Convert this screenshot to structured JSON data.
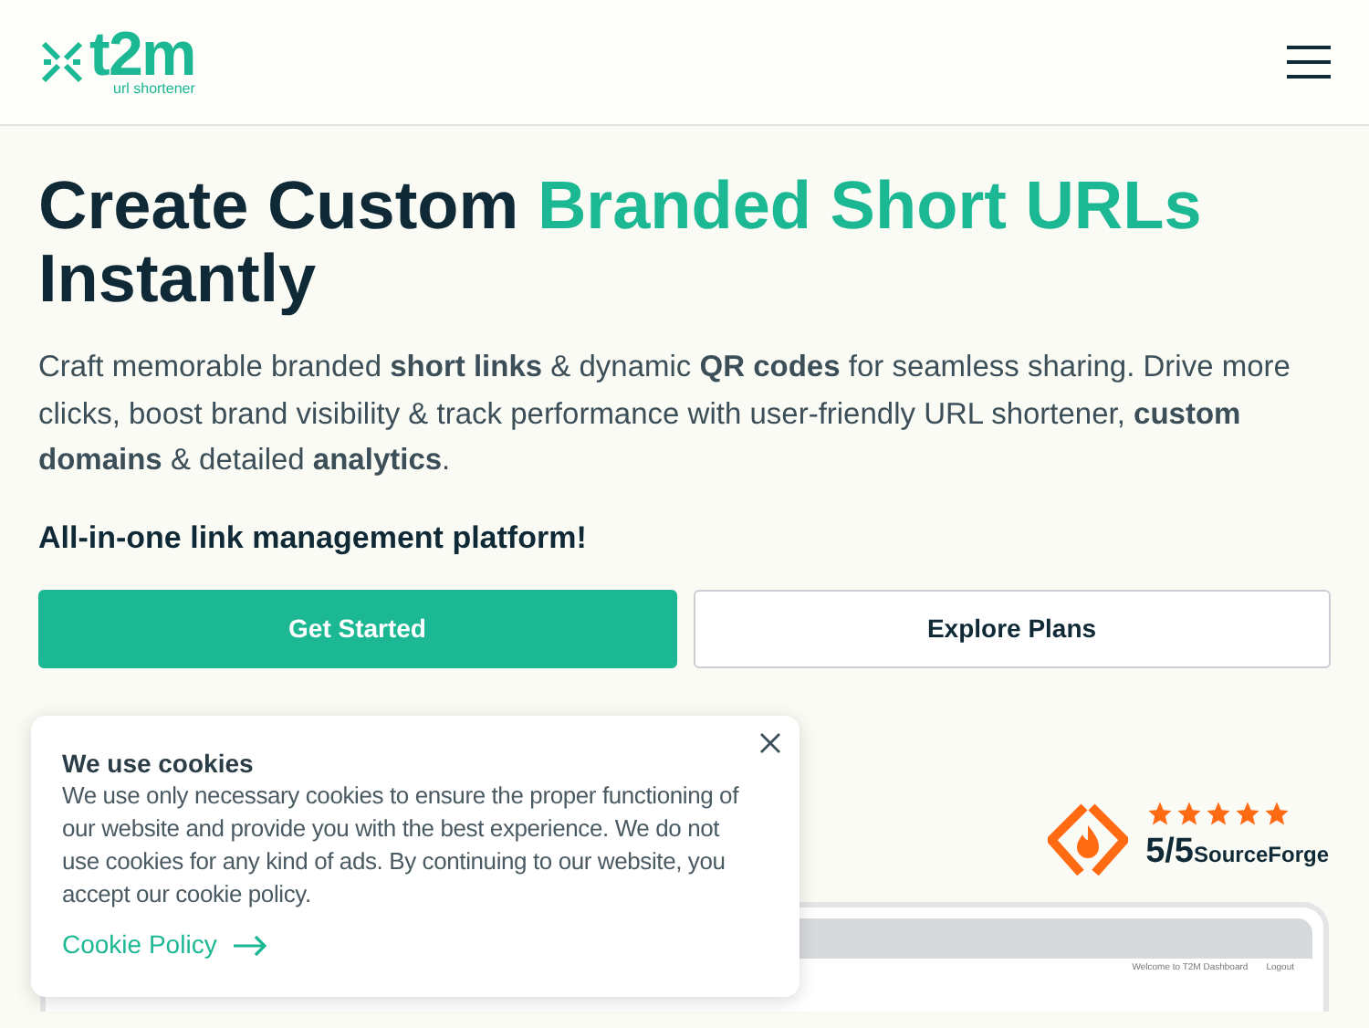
{
  "header": {
    "logo_text": "t2m",
    "logo_tagline": "url shortener"
  },
  "hero": {
    "title_parts": [
      {
        "text": "Create Custom ",
        "accent": false
      },
      {
        "text": "Branded Short URLs",
        "accent": true
      },
      {
        "text": " Instantly",
        "accent": false
      }
    ],
    "description": "Craft memorable branded **short links** & dynamic **QR codes** for seamless sharing. Drive more clicks, boost brand visibility & track performance with user-friendly URL shortener, **custom domains** & detailed **analytics**.",
    "tagline": "All-in-one link management platform!",
    "buttons": [
      {
        "label": "Get Started",
        "kind": "primary"
      },
      {
        "label": "Explore Plans",
        "kind": "outline"
      }
    ]
  },
  "rating": {
    "stars": 5,
    "score": "5/5",
    "source": "SourceForge"
  },
  "dashboard_preview": {
    "welcome": "Welcome to T2M Dashboard",
    "logout": "Logout"
  },
  "cookie_banner": {
    "title": "We use cookies",
    "text": "We use only necessary cookies to ensure the proper functioning of our website and provide you with the best experience. We do not use cookies for any kind of ads. By continuing to our website, you accept our cookie policy.",
    "link": "Cookie Policy"
  }
}
